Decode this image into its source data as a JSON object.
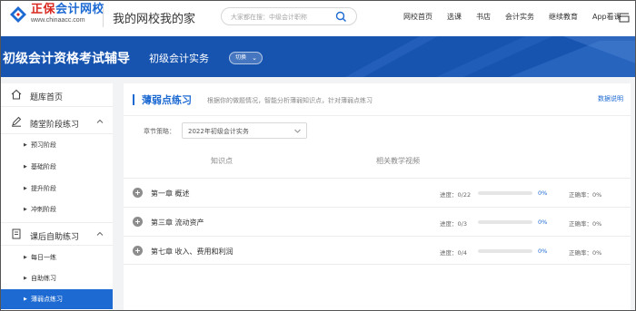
{
  "header": {
    "logo_cn_red": "正保",
    "logo_cn_blue": "会计网校",
    "logo_en": "www.chinaacc.com",
    "slogan": "我的网校我的家",
    "search_placeholder": "大家都在搜：中级会计职称",
    "nav": [
      "网校首页",
      "选课",
      "书店",
      "会计实务",
      "继续教育",
      "App看课"
    ]
  },
  "banner": {
    "title": "初级会计资格考试辅导",
    "subtitle": "初级会计实务",
    "switch_label": "切换"
  },
  "sidebar": {
    "home": "题库首页",
    "group1": {
      "label": "随堂阶段练习",
      "items": [
        "预习阶段",
        "基础阶段",
        "提升阶段",
        "冲刺阶段"
      ]
    },
    "group2": {
      "label": "课后自助练习",
      "items": [
        "每日一练",
        "自助练习",
        "薄弱点练习"
      ]
    }
  },
  "main": {
    "title": "薄弱点练习",
    "description": "根据你的做题情况，智能分析薄弱知识点，针对薄弱点练习",
    "help_link": "数据说明",
    "filter_label": "章节策略：",
    "filter_value": "2022年初级会计实务",
    "col_knowledge": "知识点",
    "col_video": "相关教学视频",
    "rows": [
      {
        "name": "第一章  概述",
        "progress_label": "进度：0/22",
        "progress": 0,
        "pct": "0%",
        "accuracy": "正确率：0%"
      },
      {
        "name": "第三章  流动资产",
        "progress_label": "进度：0/3",
        "progress": 0,
        "pct": "0%",
        "accuracy": "正确率：0%"
      },
      {
        "name": "第七章  收入、费用和利润",
        "progress_label": "进度：0/4",
        "progress": 0,
        "pct": "0%",
        "accuracy": "正确率：0%"
      }
    ]
  },
  "colors": {
    "brand_blue": "#1d6ad2",
    "banner_blue": "#1754b0",
    "logo_red": "#d8281f"
  }
}
